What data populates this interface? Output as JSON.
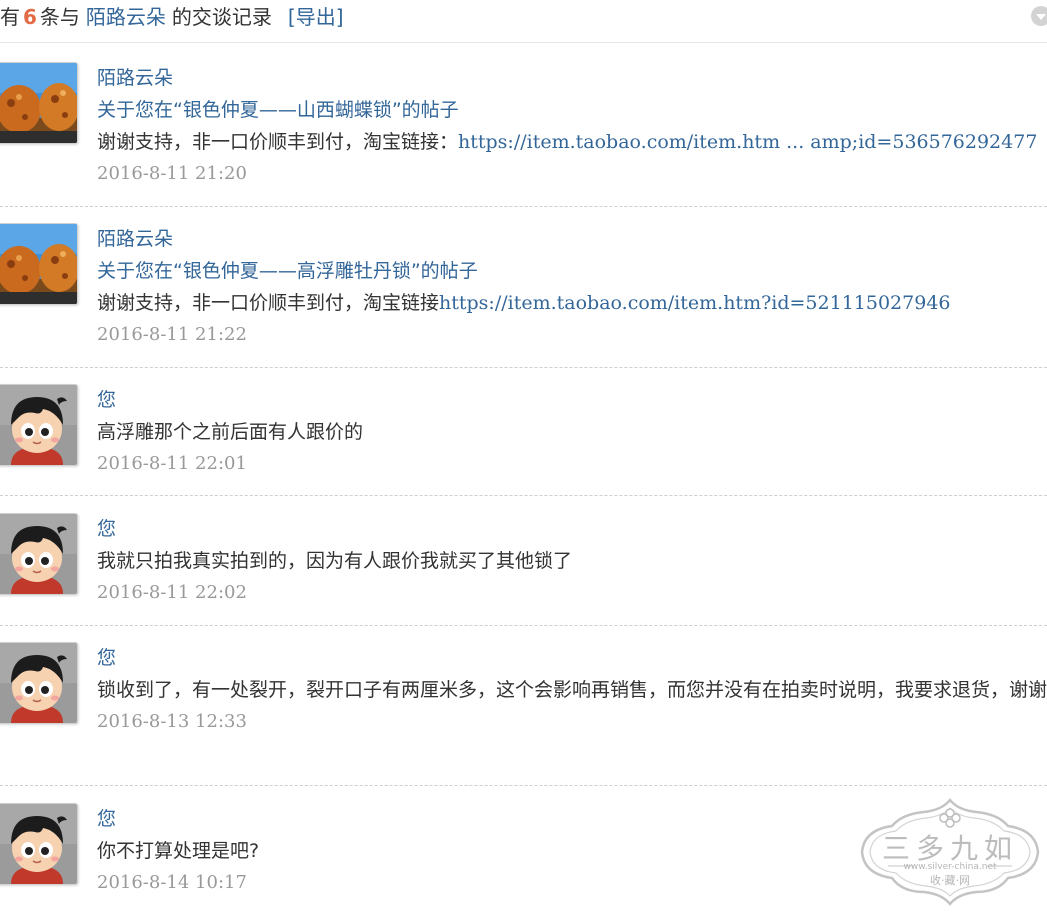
{
  "header": {
    "prefix": "有",
    "count": "6",
    "mid": "条与",
    "partner": "陌路云朵",
    "suffix": "的交谈记录",
    "export_label": "[导出]"
  },
  "messages": [
    {
      "avatar": "cookie-avatar-icon",
      "sender": "陌路云朵",
      "subject": "关于您在“银色仲夏——山西蝴蝶锁”的帖子",
      "text": "谢谢支持，非一口价顺丰到付，淘宝链接：",
      "link": "https://item.taobao.com/item.htm ... amp;id=536576292477",
      "time": "2016-8-11 21:20"
    },
    {
      "avatar": "cookie-avatar-icon",
      "sender": "陌路云朵",
      "subject": "关于您在“银色仲夏——高浮雕牡丹锁”的帖子",
      "text": "谢谢支持，非一口价顺丰到付，淘宝链接",
      "link": "https://item.taobao.com/item.htm?id=521115027946",
      "time": "2016-8-11 21:22"
    },
    {
      "avatar": "cartoon-boy-avatar-icon",
      "sender": "您",
      "text": "高浮雕那个之前后面有人跟价的",
      "time": "2016-8-11 22:01"
    },
    {
      "avatar": "cartoon-boy-avatar-icon",
      "sender": "您",
      "text": "我就只拍我真实拍到的，因为有人跟价我就买了其他锁了",
      "time": "2016-8-11 22:02"
    },
    {
      "avatar": "cartoon-boy-avatar-icon",
      "sender": "您",
      "text": "锁收到了，有一处裂开，裂开口子有两厘米多，这个会影响再销售，而您并没有在拍卖时说明，我要求退货，谢谢",
      "time": "2016-8-13 12:33"
    },
    {
      "avatar": "cartoon-boy-avatar-icon",
      "sender": "您",
      "text": "你不打算处理是吧?",
      "time": "2016-8-14 10:17"
    }
  ],
  "watermark": {
    "title": "三多九如",
    "url": "www.silver-china.net",
    "subtitle": "收·藏·网"
  },
  "colors": {
    "link": "#336699",
    "count_highlight": "#e36c46",
    "time": "#999999",
    "text": "#333333"
  }
}
